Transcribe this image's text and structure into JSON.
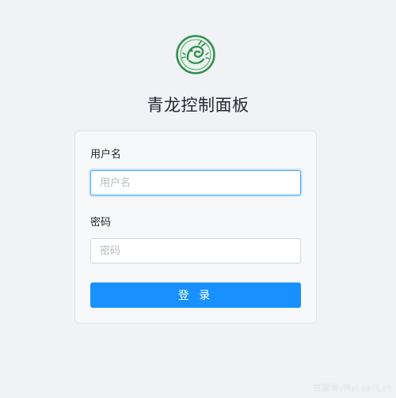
{
  "app": {
    "title": "青龙控制面板",
    "logo_icon": "qinglong-dragon-logo-icon"
  },
  "login_form": {
    "username": {
      "label": "用户名",
      "placeholder": "用户名",
      "value": ""
    },
    "password": {
      "label": "密码",
      "placeholder": "密码",
      "value": ""
    },
    "submit_label": "登 录"
  },
  "watermark": "百家号/MulderLzt",
  "colors": {
    "page_bg": "#f0f2f5",
    "card_bg": "#f6f8fa",
    "primary": "#1890ff",
    "focus_border": "#40a9ff",
    "logo_green": "#2f8f4e"
  }
}
